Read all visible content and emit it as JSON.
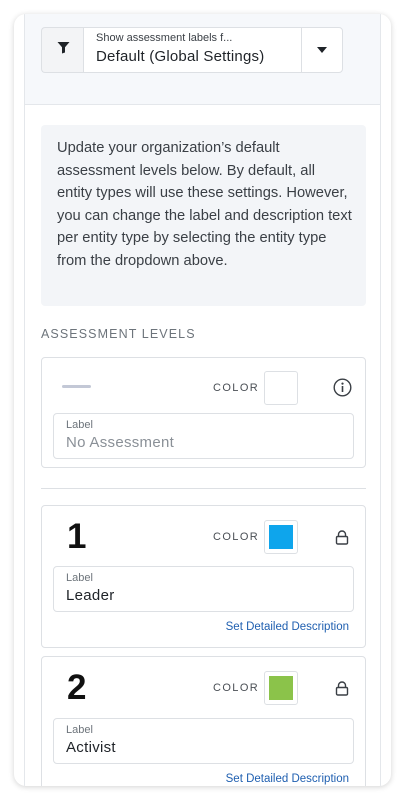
{
  "header": {
    "filter_icon": "filter-icon",
    "select_caption": "Show assessment labels f...",
    "select_value": "Default (Global Settings)",
    "dropdown_icon": "caret-down-icon"
  },
  "info_text": "Update your organization’s default assessment levels below. By default, all entity types will use these settings. However, you can change the label and description text per entity type by selecting the entity type from the dropdown above.",
  "section_title": "ASSESSMENT LEVELS",
  "levels": [
    {
      "number": "",
      "color_label": "COLOR",
      "color": "#ffffff",
      "side_icon": "info-icon",
      "field_label": "Label",
      "field_value": "No Assessment",
      "is_placeholder": true,
      "link": ""
    },
    {
      "number": "1",
      "color_label": "COLOR",
      "color": "#0ea5ec",
      "side_icon": "lock-icon",
      "field_label": "Label",
      "field_value": "Leader",
      "link": "Set Detailed Description"
    },
    {
      "number": "2",
      "color_label": "COLOR",
      "color": "#8bc34a",
      "side_icon": "lock-icon",
      "field_label": "Label",
      "field_value": "Activist",
      "link": "Set Detailed Description"
    }
  ]
}
